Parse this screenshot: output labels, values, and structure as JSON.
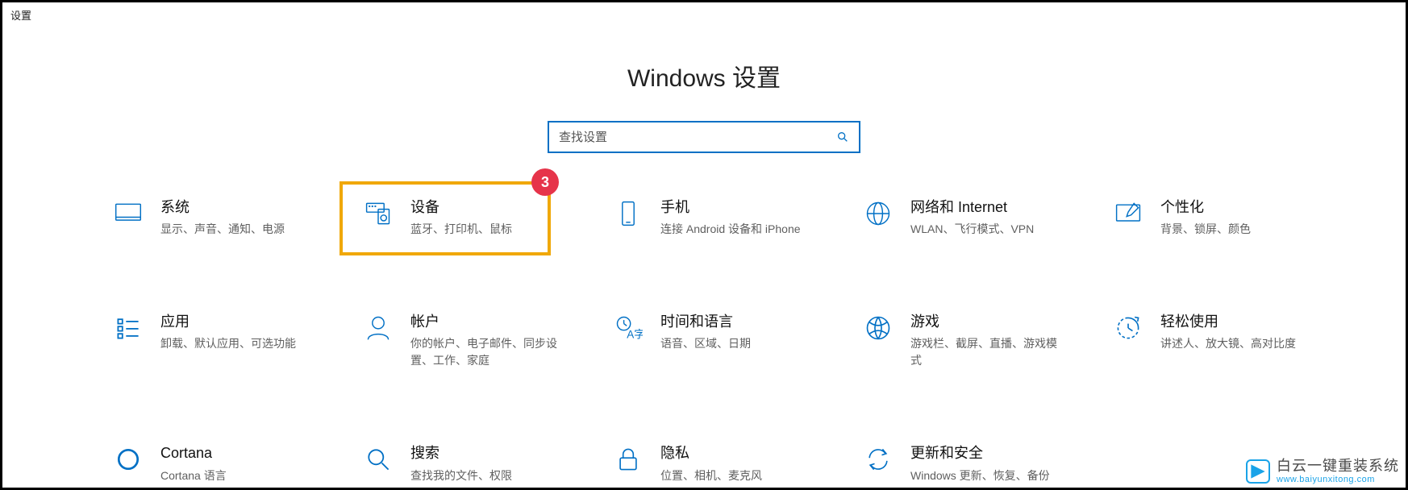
{
  "window": {
    "title": "设置"
  },
  "page": {
    "heading": "Windows 设置"
  },
  "search": {
    "placeholder": "查找设置"
  },
  "annotation": {
    "badge": "3"
  },
  "tiles": {
    "system": {
      "title": "系统",
      "sub": "显示、声音、通知、电源"
    },
    "devices": {
      "title": "设备",
      "sub": "蓝牙、打印机、鼠标"
    },
    "phone": {
      "title": "手机",
      "sub": "连接 Android 设备和 iPhone"
    },
    "network": {
      "title": "网络和 Internet",
      "sub": "WLAN、飞行模式、VPN"
    },
    "personal": {
      "title": "个性化",
      "sub": "背景、锁屏、颜色"
    },
    "apps": {
      "title": "应用",
      "sub": "卸载、默认应用、可选功能"
    },
    "accounts": {
      "title": "帐户",
      "sub": "你的帐户、电子邮件、同步设置、工作、家庭"
    },
    "time": {
      "title": "时间和语言",
      "sub": "语音、区域、日期"
    },
    "gaming": {
      "title": "游戏",
      "sub": "游戏栏、截屏、直播、游戏模式"
    },
    "ease": {
      "title": "轻松使用",
      "sub": "讲述人、放大镜、高对比度"
    },
    "cortana": {
      "title": "Cortana",
      "sub": "Cortana 语言"
    },
    "searchc": {
      "title": "搜索",
      "sub": "查找我的文件、权限"
    },
    "privacy": {
      "title": "隐私",
      "sub": "位置、相机、麦克风"
    },
    "update": {
      "title": "更新和安全",
      "sub": "Windows 更新、恢复、备份"
    }
  },
  "watermark": {
    "title": "白云一键重装系统",
    "url": "www.baiyunxitong.com"
  }
}
